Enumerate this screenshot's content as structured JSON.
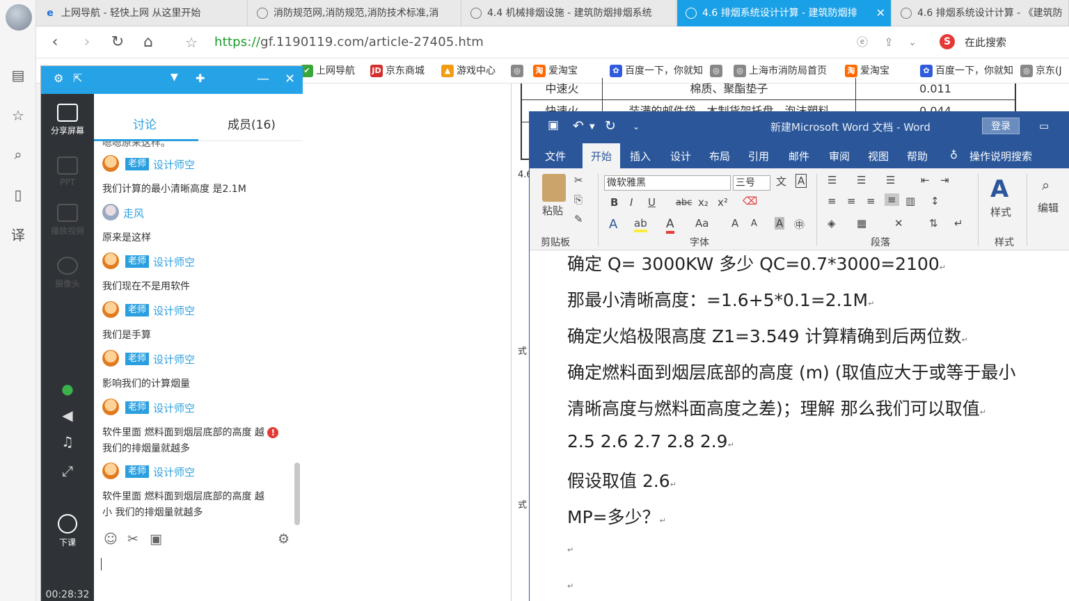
{
  "browser": {
    "tabs": [
      {
        "title": "上网导航 - 轻快上网 从这里开始",
        "icon": "ie-icon"
      },
      {
        "title": "消防规范网,消防规范,消防技术标准,消",
        "icon": "globe-icon"
      },
      {
        "title": "4.4 机械排烟设施 - 建筑防烟排烟系统",
        "icon": "globe-icon"
      },
      {
        "title": "4.6 排烟系统设计计算 - 建筑防烟排",
        "icon": "globe-icon",
        "close": "✕"
      },
      {
        "title": "4.6 排烟系统设计计算 - 《建筑防",
        "icon": "globe-icon"
      }
    ],
    "url_protocol": "https://",
    "url_rest": "gf.1190119.com/article-27405.htm",
    "search_placeholder": "在此搜索",
    "bookmarks": [
      {
        "label": "上网导航",
        "color": "#3aa53a",
        "icon": "✔"
      },
      {
        "label": "京东商城",
        "color": "#d32f2f",
        "icon": "JD"
      },
      {
        "label": "游戏中心",
        "color": "#f39c12",
        "icon": "▲"
      },
      {
        "label": "",
        "color": "#888888",
        "icon": "◎"
      },
      {
        "label": "爱淘宝",
        "color": "#ff6a00",
        "icon": "淘"
      },
      {
        "label": "百度一下，你就知",
        "color": "#2f5bdc",
        "icon": "✿"
      },
      {
        "label": "",
        "color": "#888888",
        "icon": "◎"
      },
      {
        "label": "上海市消防局首页",
        "color": "#888888",
        "icon": "◎"
      },
      {
        "label": "爱淘宝",
        "color": "#ff6a00",
        "icon": "淘"
      },
      {
        "label": "百度一下，你就知",
        "color": "#2f5bdc",
        "icon": "✿"
      },
      {
        "label": "京东(J",
        "color": "#888888",
        "icon": "◎"
      }
    ]
  },
  "page": {
    "table_rows": [
      [
        "中速火",
        "棉质、聚酯垫子",
        "0.011"
      ],
      [
        "快速火",
        "装满的邮件袋、木制货架托盘、泡沫塑料",
        "0.044"
      ]
    ],
    "side_labels": [
      "4.6",
      "式",
      "式"
    ]
  },
  "chat": {
    "left_menu": [
      {
        "label": "分享屏幕",
        "state": "on"
      },
      {
        "label": "PPT",
        "state": "dim"
      },
      {
        "label": "播放视频",
        "state": "dim"
      },
      {
        "label": "摄像头",
        "state": "dim"
      }
    ],
    "end_class_label": "下课",
    "timer": "00:28:32",
    "tabs": {
      "discussion": "讨论",
      "members": "成员(16)"
    },
    "partial_top": "嗯嗯原来这样。",
    "messages": [
      {
        "badge": "老师",
        "user": "设计师空",
        "text": "我们计算的最小清晰高度  是2.1M",
        "avatar": "teacher"
      },
      {
        "badge": "",
        "user": "走风",
        "text": "原来是这样",
        "avatar": "student"
      },
      {
        "badge": "老师",
        "user": "设计师空",
        "text": "我们现在不是用软件",
        "avatar": "teacher"
      },
      {
        "badge": "老师",
        "user": "设计师空",
        "text": "我们是手算",
        "avatar": "teacher"
      },
      {
        "badge": "老师",
        "user": "设计师空",
        "text": "影响我们的计算烟量",
        "avatar": "teacher"
      },
      {
        "badge": "老师",
        "user": "设计师空",
        "text": "软件里面 燃料面到烟层底部的高度 越",
        "text2": "我们的排烟量就越多",
        "error": true,
        "avatar": "teacher"
      },
      {
        "badge": "老师",
        "user": "设计师空",
        "text": "软件里面 燃料面到烟层底部的高度 越",
        "text2": "小 我们的排烟量就越多",
        "avatar": "teacher"
      }
    ]
  },
  "word": {
    "title": "新建Microsoft Word 文档  -  Word",
    "login": "登录",
    "tabs": [
      "文件",
      "开始",
      "插入",
      "设计",
      "布局",
      "引用",
      "邮件",
      "审阅",
      "视图",
      "帮助"
    ],
    "active_tab": "开始",
    "tell_me": "操作说明搜索",
    "font_name": "微软雅黑",
    "font_size": "三号",
    "groups": {
      "clipboard": "剪贴板",
      "font": "字体",
      "paragraph": "段落",
      "styles": "样式"
    },
    "paste_label": "粘贴",
    "styles_label": "样式",
    "edit_label": "编辑",
    "doc_lines": [
      "确定 Q=    3000KW 多少    QC=0.7*3000=2100",
      "那最小清晰高度：=1.6+5*0.1=2.1M",
      "确定火焰极限高度 Z1=3.549      计算精确到后两位数",
      "确定燃料面到烟层底部的高度 (m) (取值应大于或等于最小",
      "清晰高度与燃料面高度之差)；理解      那么我们可以取值",
      "2.5     2.6     2.7     2.8     2.9",
      "假设取值 2.6",
      "MP=多少？"
    ],
    "para_mark": "↵"
  }
}
